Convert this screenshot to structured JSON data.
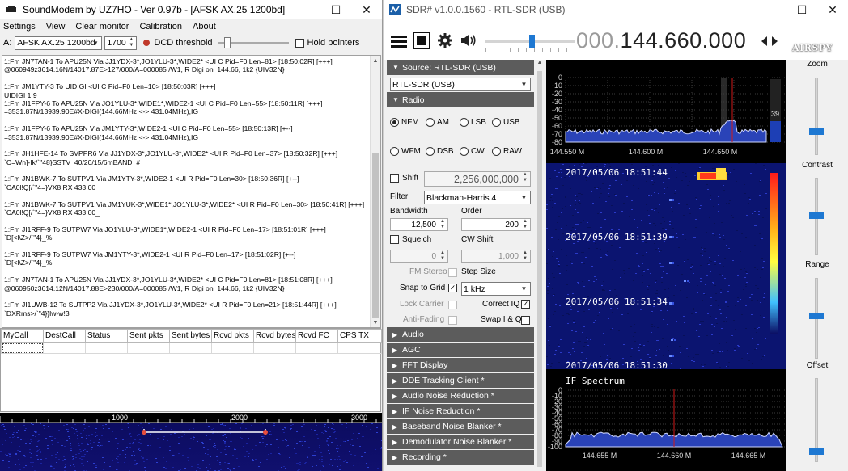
{
  "soundmodem": {
    "title": "SoundModem by UZ7HO - Ver 0.97b - [AFSK AX.25 1200bd]",
    "menu": [
      "Settings",
      "View",
      "Clear monitor",
      "Calibration",
      "About"
    ],
    "channel_label": "A:",
    "mode": "AFSK AX.25 1200bd",
    "center_freq": "1700",
    "dcd_label": "DCD threshold",
    "hold_pointers_label": "Hold pointers",
    "log_lines": [
      "1:Fm JN7TAN-1 To APU25N Via JJ1YDX-3*,JO1YLU-3*,WIDE2* <UI C Pid=F0 Len=81> [18:50:02R] [+++]",
      "@060949z3614.16N/14017.87E>127/000/A=000085 /W1, R Digi on  144.66, 1k2 {UIV32N}",
      "",
      "1:Fm JM1YTY-3 To UIDIGI <UI C Pid=F0 Len=10> [18:50:03R] [+++]",
      "UIDIGI 1.9",
      "1:Fm JI1FPY-6 To APU25N Via JO1YLU-3*,WIDE1*,WIDE2-1 <UI C Pid=F0 Len=55> [18:50:11R] [+++]",
      "=3531.87N/13939.90E#X-DIGI(144.66MHz <-> 431.04MHz),IG",
      "",
      "1:Fm JI1FPY-6 To APU25N Via JM1YTY-3*,WIDE2-1 <UI C Pid=F0 Len=55> [18:50:13R] [+--]",
      "=3531.87N/13939.90E#X-DIGI(144.66MHz <-> 431.04MHz),IG",
      "",
      "1:Fm JH1HFE-14 To SVPPR6 Via JJ1YDX-3*,JO1YLU-3*,WIDE2* <UI R Pid=F0 Len=37> [18:50:32R] [+++]",
      "`C=Wn]-Ik/`\"48}SSTV_40/20/15/6mBAND_#",
      "",
      "1:Fm JN1BWK-7 To SUTPV1 Via JM1YTY-3*,WIDE2-1 <UI R Pid=F0 Len=30> [18:50:36R] [+--]",
      "`CA0l!Q[/`\"4=}VX8 RX 433.00_",
      "",
      "1:Fm JN1BWK-7 To SUTPV1 Via JM1YUK-3*,WIDE1*,JO1YLU-3*,WIDE2* <UI R Pid=F0 Len=30> [18:50:41R] [+++]",
      "`CA0l!Q[/`\"4=}VX8 RX 433.00_",
      "",
      "1:Fm JI1RFF-9 To SUTPW7 Via JO1YLU-3*,WIDE1*,WIDE2-1 <UI R Pid=F0 Len=17> [18:51:01R] [+++]",
      "`D[<l\\Z>/`\"4}_%",
      "",
      "1:Fm JI1RFF-9 To SUTPW7 Via JM1YTY-3*,WIDE2-1 <UI R Pid=F0 Len=17> [18:51:02R] [+--]",
      "`D[<l\\Z>/`\"4}_%",
      "",
      "1:Fm JN7TAN-1 To APU25N Via JJ1YDX-3*,JO1YLU-3*,WIDE2* <UI C Pid=F0 Len=81> [18:51:08R] [+++]",
      "@060950z3614.12N/14017.88E>230/000/A=000085 /W1, R Digi on  144.66, 1k2 {UIV32N}",
      "",
      "1:Fm JI1UWB-12 To SUTPP2 Via JJ1YDX-3*,JO1YLU-3*,WIDE2* <UI R Pid=F0 Len=21> [18:51:44R] [+++]",
      "`DXRms>/`\"4}}lw-w!3"
    ],
    "stats_columns": [
      "MyCall",
      "DestCall",
      "Status",
      "Sent pkts",
      "Sent bytes",
      "Rcvd pkts",
      "Rcvd bytes",
      "Rcvd FC",
      "CPS TX"
    ],
    "waterfall_scale": [
      "1000",
      "2000",
      "3000"
    ]
  },
  "sdr": {
    "title": "SDR# v1.0.0.1560 - RTL-SDR (USB)",
    "freq_dim": "000.",
    "freq_main": "144.660.000",
    "logo_text": "AIRSPY",
    "source_header": "Source: RTL-SDR (USB)",
    "source_value": "RTL-SDR (USB)",
    "radio_header": "Radio",
    "modes_row1": [
      "NFM",
      "AM",
      "LSB",
      "USB"
    ],
    "modes_row2": [
      "WFM",
      "DSB",
      "CW",
      "RAW"
    ],
    "selected_mode": "NFM",
    "shift_label": "Shift",
    "shift_value": "2,256,000,000",
    "filter_label": "Filter",
    "filter_value": "Blackman-Harris 4",
    "bandwidth_label": "Bandwidth",
    "order_label": "Order",
    "bandwidth_value": "12,500",
    "order_value": "200",
    "squelch_label": "Squelch",
    "cwshift_label": "CW Shift",
    "squelch_value": "0",
    "cwshift_value": "1,000",
    "fm_stereo_label": "FM Stereo",
    "step_size_label": "Step Size",
    "snap_label": "Snap to Grid",
    "step_value": "1 kHz",
    "lock_carrier_label": "Lock Carrier",
    "correct_iq_label": "Correct IQ",
    "anti_fading_label": "Anti-Fading",
    "swap_iq_label": "Swap I & Q",
    "collapsed_sections": [
      "Audio",
      "AGC",
      "FFT Display",
      "DDE Tracking Client *",
      "Audio Noise Reduction *",
      "IF Noise Reduction *",
      "Baseband Noise Blanker *",
      "Demodulator Noise Blanker *",
      "Recording *"
    ],
    "spectrum_db": [
      "0",
      "-10",
      "-20",
      "-30",
      "-40",
      "-50",
      "-60",
      "-70",
      "-80"
    ],
    "spectrum_freqs": [
      "144.550 M",
      "144.600 M",
      "144.650 M"
    ],
    "spectrum_level": "39",
    "timestamps": [
      "2017/05/06 18:51:44",
      "2017/05/06 18:51:39",
      "2017/05/06 18:51:34",
      "2017/05/06 18:51:30"
    ],
    "if_title": "IF Spectrum",
    "if_db": [
      "0",
      "-10",
      "-20",
      "-30",
      "-40",
      "-50",
      "-60",
      "-70",
      "-80",
      "-90",
      "-100"
    ],
    "if_freqs": [
      "144.655 M",
      "144.660 M",
      "144.665 M"
    ],
    "right_labels": [
      "Zoom",
      "Contrast",
      "Range",
      "Offset"
    ]
  }
}
